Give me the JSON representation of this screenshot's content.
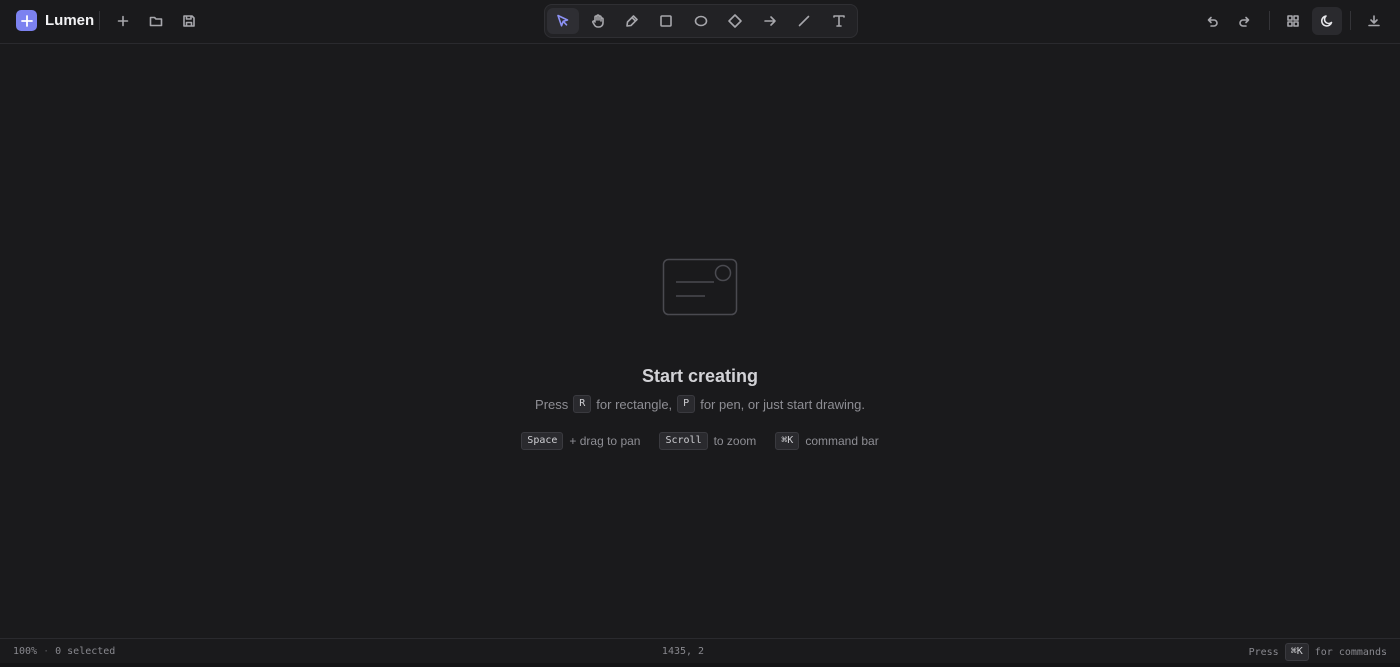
{
  "app": {
    "name": "Lumen"
  },
  "header": {
    "file_actions": [
      {
        "name": "new-file-button",
        "icon": "plus-icon"
      },
      {
        "name": "open-file-button",
        "icon": "folder-icon"
      },
      {
        "name": "save-file-button",
        "icon": "save-icon"
      }
    ],
    "tools": [
      {
        "name": "select",
        "icon": "cursor-icon",
        "active": true
      },
      {
        "name": "hand",
        "icon": "hand-icon"
      },
      {
        "name": "pen",
        "icon": "pen-icon"
      },
      {
        "name": "rectangle",
        "icon": "square-icon"
      },
      {
        "name": "ellipse",
        "icon": "ellipse-icon"
      },
      {
        "name": "diamond",
        "icon": "diamond-icon"
      },
      {
        "name": "arrow",
        "icon": "arrow-right-icon"
      },
      {
        "name": "line",
        "icon": "line-icon"
      },
      {
        "name": "text",
        "icon": "text-icon"
      }
    ],
    "right_actions": [
      {
        "name": "undo-button",
        "icon": "undo-icon"
      },
      {
        "name": "redo-button",
        "icon": "redo-icon"
      },
      {
        "name": "grid-toggle-button",
        "icon": "grid-icon"
      },
      {
        "name": "theme-toggle-button",
        "icon": "moon-icon"
      },
      {
        "name": "export-button",
        "icon": "download-icon"
      }
    ]
  },
  "empty_state": {
    "title": "Start creating",
    "line1": {
      "press": "Press",
      "key_r": "R",
      "for_rect": "for rectangle,",
      "key_p": "P",
      "for_pen": "for pen, or just start drawing."
    },
    "line2": {
      "pan_key": "Space",
      "pan_text": "+ drag to pan",
      "zoom_key": "Scroll",
      "zoom_text": "to zoom",
      "cmd_key": "⌘K",
      "cmd_text": "command bar"
    }
  },
  "status": {
    "zoom": "100%",
    "separator": "·",
    "selected": "0 selected",
    "coords": "1435, 2",
    "press": "Press",
    "cmd_key": "⌘K",
    "for_commands": "for commands"
  },
  "colors": {
    "accent": "#7c82f0",
    "background": "#1a1a1c",
    "active_tool": "#8d92f5"
  }
}
